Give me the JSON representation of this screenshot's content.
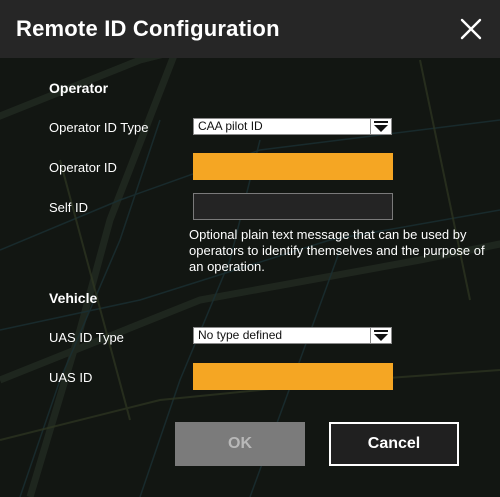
{
  "dialog": {
    "title": "Remote ID Configuration",
    "close_icon": "close-icon"
  },
  "operator": {
    "section_label": "Operator",
    "id_type_label": "Operator ID Type",
    "id_type_value": "CAA pilot ID",
    "operator_id_label": "Operator ID",
    "operator_id_value": "",
    "self_id_label": "Self ID",
    "self_id_value": "",
    "self_id_help": "Optional plain text message that can be used by operators to identify themselves and the purpose of an operation."
  },
  "vehicle": {
    "section_label": "Vehicle",
    "uas_id_type_label": "UAS ID Type",
    "uas_id_type_value": "No type defined",
    "uas_id_label": "UAS ID",
    "uas_id_value": ""
  },
  "buttons": {
    "ok_label": "OK",
    "cancel_label": "Cancel"
  },
  "colors": {
    "required_field": "#f5a623",
    "title_bar": "#262626",
    "ok_disabled": "#7b7b7b"
  }
}
